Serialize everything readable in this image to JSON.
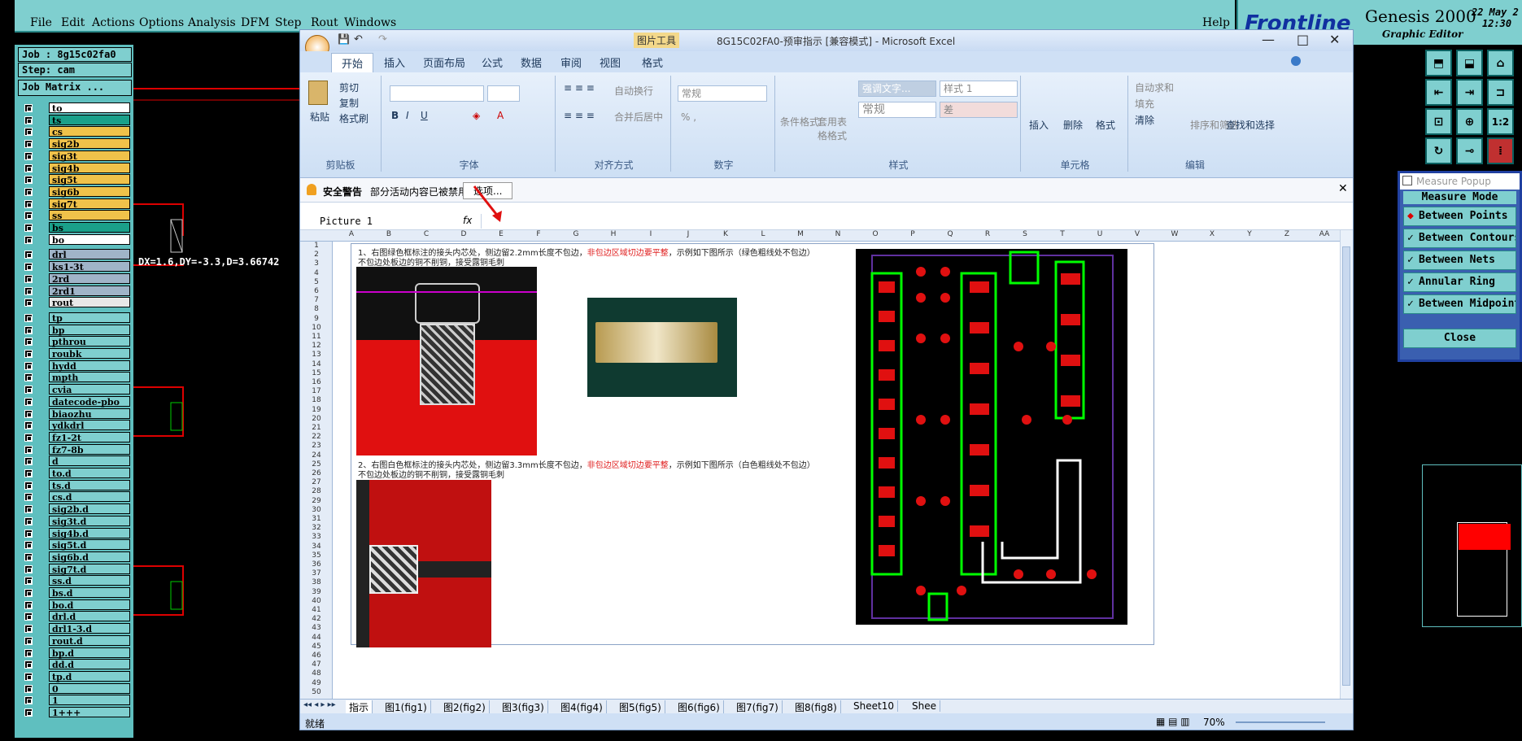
{
  "genesis": {
    "menu": [
      "File",
      "Edit",
      "Actions",
      "Options",
      "Analysis",
      "DFM",
      "Step",
      "Rout",
      "Windows"
    ],
    "help": "Help",
    "brand": "Frontline",
    "product": "Genesis 2000",
    "subtitle": "Graphic Editor",
    "date": "22 May 2",
    "time": "12:30",
    "job": "Job : 8g15c02fa0",
    "step": "Step: cam",
    "job_matrix": "Job Matrix ...",
    "measure_text": "DX=1.6,DY=-3.3,D=3.66742",
    "layers": [
      {
        "name": "to",
        "color": "#ffffff"
      },
      {
        "name": "ts",
        "color": "#1aa08a"
      },
      {
        "name": "cs",
        "color": "#f0c24a"
      },
      {
        "name": "sig2b",
        "color": "#f0c24a"
      },
      {
        "name": "sig3t",
        "color": "#f0c24a"
      },
      {
        "name": "sig4b",
        "color": "#f0c24a"
      },
      {
        "name": "sig5t",
        "color": "#f0c24a"
      },
      {
        "name": "sig6b",
        "color": "#f0c24a"
      },
      {
        "name": "sig7t",
        "color": "#f0c24a"
      },
      {
        "name": "ss",
        "color": "#f0c24a"
      },
      {
        "name": "bs",
        "color": "#1aa08a"
      },
      {
        "name": "bo",
        "color": "#ffffff"
      },
      {
        "name": "drl",
        "color": "#a0b4c8"
      },
      {
        "name": "ks1-3t",
        "color": "#a0b4c8"
      },
      {
        "name": "2rd",
        "color": "#a0b4c8"
      },
      {
        "name": "2rd1",
        "color": "#a0b4c8"
      },
      {
        "name": "rout",
        "color": "#e8e8e8"
      },
      {
        "name": "tp",
        "color": "#7fcfcf"
      },
      {
        "name": "bp",
        "color": "#7fcfcf"
      },
      {
        "name": "pthrou",
        "color": "#7fcfcf"
      },
      {
        "name": "roubk",
        "color": "#7fcfcf"
      },
      {
        "name": "hydd",
        "color": "#7fcfcf"
      },
      {
        "name": "mpth",
        "color": "#7fcfcf"
      },
      {
        "name": "cvia",
        "color": "#7fcfcf"
      },
      {
        "name": "datecode-pbo",
        "color": "#7fcfcf"
      },
      {
        "name": "biaozhu",
        "color": "#7fcfcf"
      },
      {
        "name": "ydkdrl",
        "color": "#7fcfcf"
      },
      {
        "name": "fz1-2t",
        "color": "#7fcfcf"
      },
      {
        "name": "fz7-8b",
        "color": "#7fcfcf"
      },
      {
        "name": "d",
        "color": "#7fcfcf"
      },
      {
        "name": "to.d",
        "color": "#7fcfcf"
      },
      {
        "name": "ts.d",
        "color": "#7fcfcf"
      },
      {
        "name": "cs.d",
        "color": "#7fcfcf"
      },
      {
        "name": "sig2b.d",
        "color": "#7fcfcf"
      },
      {
        "name": "sig3t.d",
        "color": "#7fcfcf"
      },
      {
        "name": "sig4b.d",
        "color": "#7fcfcf"
      },
      {
        "name": "sig5t.d",
        "color": "#7fcfcf"
      },
      {
        "name": "sig6b.d",
        "color": "#7fcfcf"
      },
      {
        "name": "sig7t.d",
        "color": "#7fcfcf"
      },
      {
        "name": "ss.d",
        "color": "#7fcfcf"
      },
      {
        "name": "bs.d",
        "color": "#7fcfcf"
      },
      {
        "name": "bo.d",
        "color": "#7fcfcf"
      },
      {
        "name": "drl.d",
        "color": "#7fcfcf"
      },
      {
        "name": "drl1-3.d",
        "color": "#7fcfcf"
      },
      {
        "name": "rout.d",
        "color": "#7fcfcf"
      },
      {
        "name": "bp.d",
        "color": "#7fcfcf"
      },
      {
        "name": "dd.d",
        "color": "#7fcfcf"
      },
      {
        "name": "tp.d",
        "color": "#7fcfcf"
      },
      {
        "name": "0",
        "color": "#7fcfcf"
      },
      {
        "name": "1",
        "color": "#7fcfcf"
      },
      {
        "name": "1+++",
        "color": "#7fcfcf"
      }
    ],
    "measure_popup": {
      "title": "Measure Popup",
      "mode_header": "Measure Mode",
      "options": [
        "Between Points",
        "Between Contours",
        "Between Nets",
        "Annular Ring",
        "Between Midpoints"
      ],
      "close": "Close"
    },
    "toolbar_labels": [
      "1:2"
    ]
  },
  "excel": {
    "title": "8G15C02FA0-预审指示 [兼容模式] - Microsoft Excel",
    "picture_tools": "图片工具",
    "tabs": [
      "开始",
      "插入",
      "页面布局",
      "公式",
      "数据",
      "审阅",
      "视图",
      "格式"
    ],
    "clipboard": {
      "paste": "粘贴",
      "cut": "剪切",
      "copy": "复制",
      "format_painter": "格式刷",
      "label": "剪贴板"
    },
    "font_label": "字体",
    "alignment": {
      "wrap": "自动换行",
      "merge": "合并后居中",
      "label": "对齐方式"
    },
    "number": {
      "format": "常规",
      "label": "数字"
    },
    "styles": {
      "cond": "条件格式",
      "table": "套用表格格式",
      "s1": "强调文字...",
      "s2": "样式 1",
      "s3": "常规",
      "s4": "差",
      "label": "样式"
    },
    "cells": {
      "insert": "插入",
      "delete": "删除",
      "format": "格式",
      "label": "单元格"
    },
    "editing": {
      "autosum": "自动求和",
      "fill": "填充",
      "clear": "清除",
      "sort": "排序和筛选",
      "find": "查找和选择",
      "label": "编辑"
    },
    "security_warning": "安全警告",
    "security_msg": "部分活动内容已被禁用。",
    "options_btn": "选项...",
    "name_box": "Picture 1",
    "fx": "fx",
    "columns": [
      "A",
      "B",
      "C",
      "D",
      "E",
      "F",
      "G",
      "H",
      "I",
      "J",
      "K",
      "L",
      "M",
      "N",
      "O",
      "P",
      "Q",
      "R",
      "S",
      "T",
      "U",
      "V",
      "W",
      "X",
      "Y",
      "Z",
      "AA"
    ],
    "note1_a": "1、右图绿色框标注的接头内芯处，侧边留2.2mm长度不包边，",
    "note1_b": "非包边区域切边要平整",
    "note1_c": "，示例如下图所示（绿色粗线处不包边）",
    "note1_d": "不包边处板边的铜不削铜，接受露铜毛刺",
    "note2_a": "2、右图白色框标注的接头内芯处，侧边留3.3mm长度不包边，",
    "note2_b": "非包边区域切边要平整",
    "note2_c": "，示例如下图所示（白色粗线处不包边）",
    "note2_d": "不包边处板边的铜不削铜，接受露铜毛刺",
    "sheets": [
      "指示",
      "图1(fig1)",
      "图2(fig2)",
      "图3(fig3)",
      "图4(fig4)",
      "图5(fig5)",
      "图6(fig6)",
      "图7(fig7)",
      "图8(fig8)",
      "Sheet10",
      "Shee"
    ],
    "status": "就绪",
    "zoom": "70%"
  }
}
